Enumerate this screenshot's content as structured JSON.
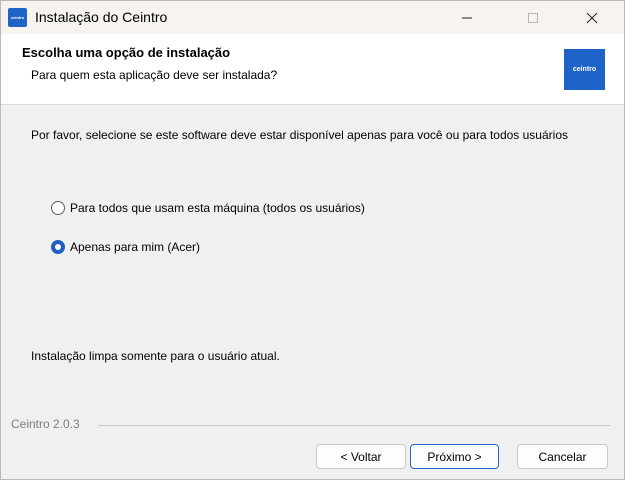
{
  "window": {
    "title": "Instalação do Ceintro",
    "app_icon_text": "ceintro"
  },
  "header": {
    "title": "Escolha uma opção de instalação",
    "subtitle": "Para quem esta aplicação deve ser instalada?",
    "logo_text": "ceintro"
  },
  "body": {
    "description": "Por favor, selecione se este software deve estar disponível apenas para você ou para todos usuários",
    "options": [
      {
        "label": "Para todos que usam esta máquina (todos os usuários)",
        "selected": false
      },
      {
        "label": "Apenas para mim (Acer)",
        "selected": true
      }
    ],
    "note": "Instalação limpa somente para o usuário atual."
  },
  "footer": {
    "brand": "Ceintro 2.0.3",
    "back_label": "< Voltar",
    "next_label": "Próximo >",
    "cancel_label": "Cancelar"
  },
  "colors": {
    "accent": "#1e63c7",
    "radio_selected": "#1f5fc4"
  }
}
